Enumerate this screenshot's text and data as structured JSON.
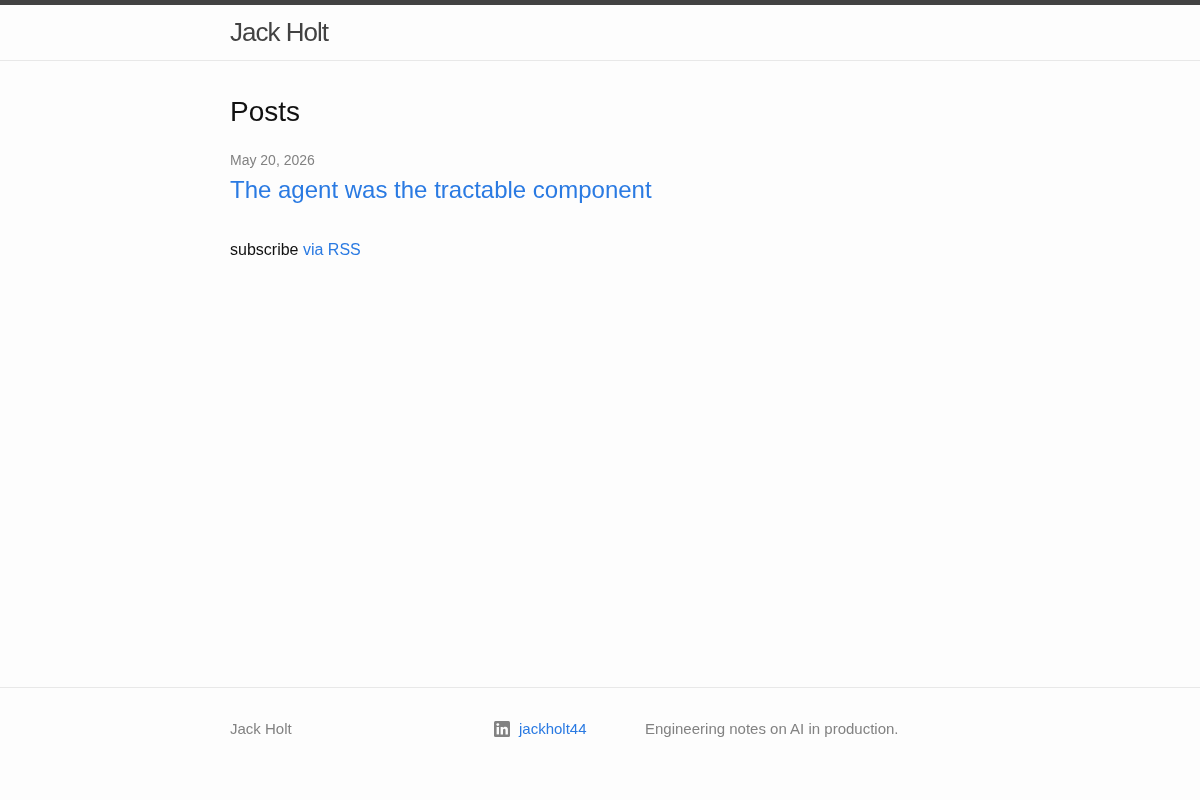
{
  "header": {
    "site_title": "Jack Holt"
  },
  "main": {
    "heading": "Posts",
    "posts": [
      {
        "date": "May 20, 2026",
        "title": "The agent was the tractable component"
      }
    ],
    "subscribe": {
      "text": "subscribe",
      "link": "via RSS"
    }
  },
  "footer": {
    "name": "Jack Holt",
    "social": [
      {
        "kind": "linkedin",
        "username": "jackholt44"
      }
    ],
    "description": "Engineering notes on AI in production."
  }
}
